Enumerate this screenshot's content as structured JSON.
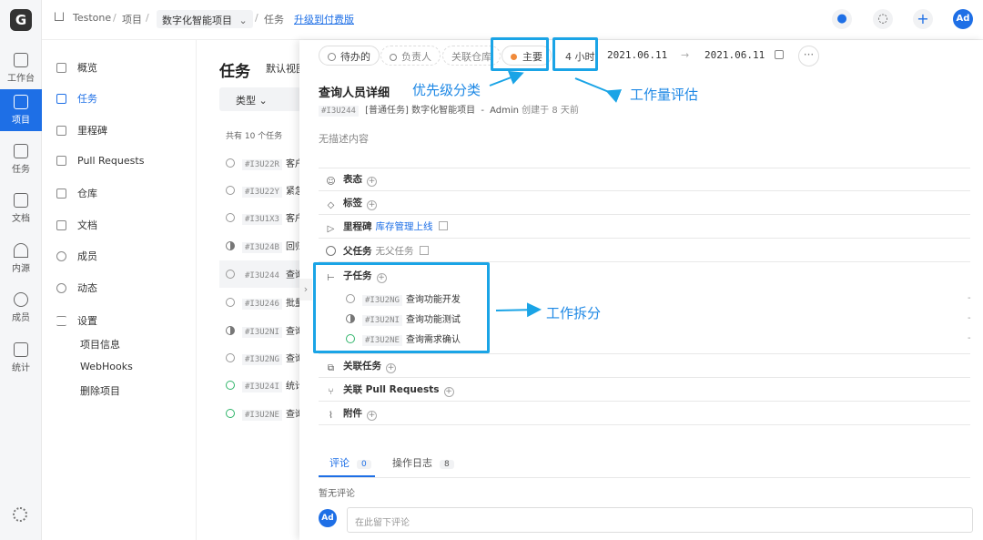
{
  "rail": {
    "items": [
      {
        "label": "工作台",
        "icon": "grid-icon"
      },
      {
        "label": "项目",
        "icon": "project-icon",
        "active": true
      },
      {
        "label": "任务",
        "icon": "task-icon"
      },
      {
        "label": "文档",
        "icon": "doc-icon"
      },
      {
        "label": "内源",
        "icon": "innersource-icon"
      },
      {
        "label": "成员",
        "icon": "members-icon"
      },
      {
        "label": "统计",
        "icon": "stats-icon"
      }
    ],
    "logo": "G"
  },
  "topbar": {
    "home": "Testone",
    "sep1": "/",
    "projects": "项目",
    "sep2": "/",
    "project_name": "数字化智能项目",
    "sep3": "/",
    "current": "任务",
    "upgrade": "升级到付费版",
    "avatar": "Ad",
    "plus": "+"
  },
  "sidebar": {
    "items": [
      {
        "label": "概览"
      },
      {
        "label": "任务",
        "active": true
      },
      {
        "label": "里程碑"
      },
      {
        "label": "Pull Requests"
      },
      {
        "label": "仓库"
      },
      {
        "label": "文档"
      },
      {
        "label": "成员"
      },
      {
        "label": "动态"
      },
      {
        "label": "设置"
      }
    ],
    "settings_sub": [
      "项目信息",
      "WebHooks",
      "删除项目"
    ]
  },
  "tasklist": {
    "title": "任务",
    "view": "默认视图",
    "filter": "类型",
    "count": "共有 10 个任务",
    "rows": [
      {
        "id": "#I3U22R",
        "name": "客户",
        "status": "todo"
      },
      {
        "id": "#I3U22Y",
        "name": "紧急",
        "status": "todo"
      },
      {
        "id": "#I3U1X3",
        "name": "客户",
        "status": "todo"
      },
      {
        "id": "#I3U24B",
        "name": "回归",
        "status": "doing"
      },
      {
        "id": "#I3U244",
        "name": "查询",
        "status": "todo",
        "selected": true
      },
      {
        "id": "#I3U246",
        "name": "批量",
        "status": "todo"
      },
      {
        "id": "#I3U2NI",
        "name": "查询",
        "status": "doing"
      },
      {
        "id": "#I3U2NG",
        "name": "查询",
        "status": "todo"
      },
      {
        "id": "#I3U24I",
        "name": "统计",
        "status": "done"
      },
      {
        "id": "#I3U2NE",
        "name": "查询",
        "status": "done"
      }
    ]
  },
  "detail": {
    "status": "待办的",
    "assignee": "负责人",
    "repo": "关联仓库",
    "priority": "主要",
    "estimate": "4 小时",
    "start_date": "2021.06.11",
    "arrow": "→",
    "end_date": "2021.06.11",
    "more": "···",
    "title": "查询人员详细",
    "id": "#I3U244",
    "type": "[普通任务]",
    "project": "数字化智能项目",
    "dash": "-",
    "creator": "Admin",
    "created": "创建于 8 天前",
    "description": "无描述内容",
    "fields": {
      "reaction": "表态",
      "tags": "标签",
      "milestone": "里程碑",
      "milestone_value": "库存管理上线",
      "parent": "父任务",
      "parent_value": "无父任务",
      "subtasks": "子任务",
      "related": "关联任务",
      "related_prs": "关联 Pull Requests",
      "attachments": "附件"
    },
    "subtasks": [
      {
        "id": "#I3U2NG",
        "name": "查询功能开发",
        "status": "todo"
      },
      {
        "id": "#I3U2NI",
        "name": "查询功能测试",
        "status": "doing"
      },
      {
        "id": "#I3U2NE",
        "name": "查询需求确认",
        "status": "done"
      }
    ],
    "tabs": [
      {
        "label": "评论",
        "count": "0"
      },
      {
        "label": "操作日志",
        "count": "8"
      }
    ],
    "no_comments": "暂无评论",
    "comment_placeholder": "在此留下评论",
    "avatar": "Ad"
  },
  "annotations": {
    "priority": "优先级分类",
    "estimate": "工作量评估",
    "subtasks": "工作拆分"
  },
  "colors": {
    "accent": "#1e6fe6",
    "annotation": "#1aa4e6",
    "priority_dot": "#f08a3a",
    "done": "#31b56b"
  }
}
